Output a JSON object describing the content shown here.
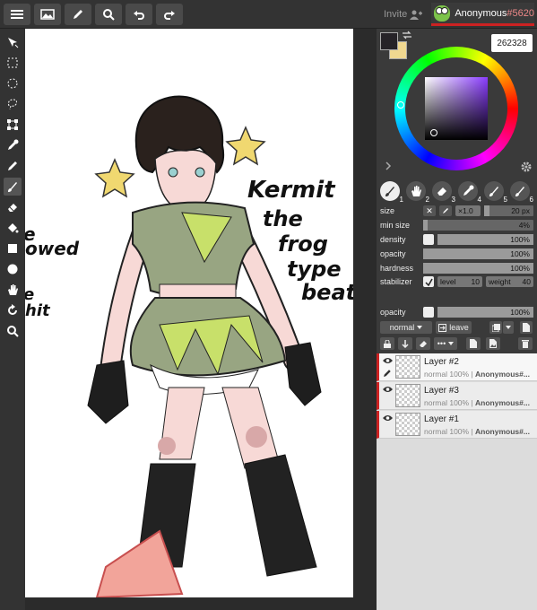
{
  "topbar": {
    "buttons": [
      {
        "name": "menu-icon"
      },
      {
        "name": "image-icon"
      },
      {
        "name": "pencil-icon"
      },
      {
        "name": "search-icon"
      },
      {
        "name": "undo-icon"
      },
      {
        "name": "redo-icon"
      }
    ],
    "invite_label": "Invite",
    "user": {
      "name": "Anonymous",
      "hash": "#5620"
    }
  },
  "tools": [
    "move-tool",
    "rect-select-tool",
    "ellipse-select-tool",
    "lasso-tool",
    "transform-tool",
    "eyedropper-tool",
    "pencil-tool",
    "brush-tool",
    "eraser-tool",
    "fill-tool",
    "rectangle-tool",
    "ellipse-tool",
    "hand-tool",
    "rotate-tool",
    "zoom-tool"
  ],
  "active_tool": "brush-tool",
  "color": {
    "hex": "262328",
    "primary": "#262328",
    "secondary": "#f0d890"
  },
  "brushes": [
    "1",
    "2",
    "3",
    "4",
    "5",
    "6"
  ],
  "brush_settings": {
    "size": {
      "label": "size",
      "mult": "×1.0",
      "value": "20 px",
      "fraction": 0.1
    },
    "min_size": {
      "label": "min size",
      "value": "4%",
      "fraction": 0.04
    },
    "density": {
      "label": "density",
      "value": "100%",
      "fraction": 1.0
    },
    "opacity": {
      "label": "opacity",
      "value": "100%",
      "fraction": 1.0
    },
    "hardness": {
      "label": "hardness",
      "value": "100%",
      "fraction": 1.0
    },
    "stabilizer": {
      "label": "stabilizer",
      "level_label": "level",
      "level": "10",
      "weight_label": "weight",
      "weight": "40"
    }
  },
  "layer_panel": {
    "opacity_label": "opacity",
    "opacity_value": "100%",
    "blend_mode": "normal",
    "leave_label": "leave",
    "layers": [
      {
        "name": "Layer #2",
        "meta": "normal 100% |",
        "owner": "Anonymous#..."
      },
      {
        "name": "Layer #3",
        "meta": "normal 100% |",
        "owner": "Anonymous#..."
      },
      {
        "name": "Layer #1",
        "meta": "normal 100% |",
        "owner": "Anonymous#..."
      }
    ]
  },
  "canvas_text": {
    "line1": "Kermit",
    "line2": "the",
    "line3": "frog",
    "line4": "type",
    "line5": "beat",
    "left1": "e",
    "left2": "owed",
    "left3": "e",
    "left4": "hit"
  }
}
